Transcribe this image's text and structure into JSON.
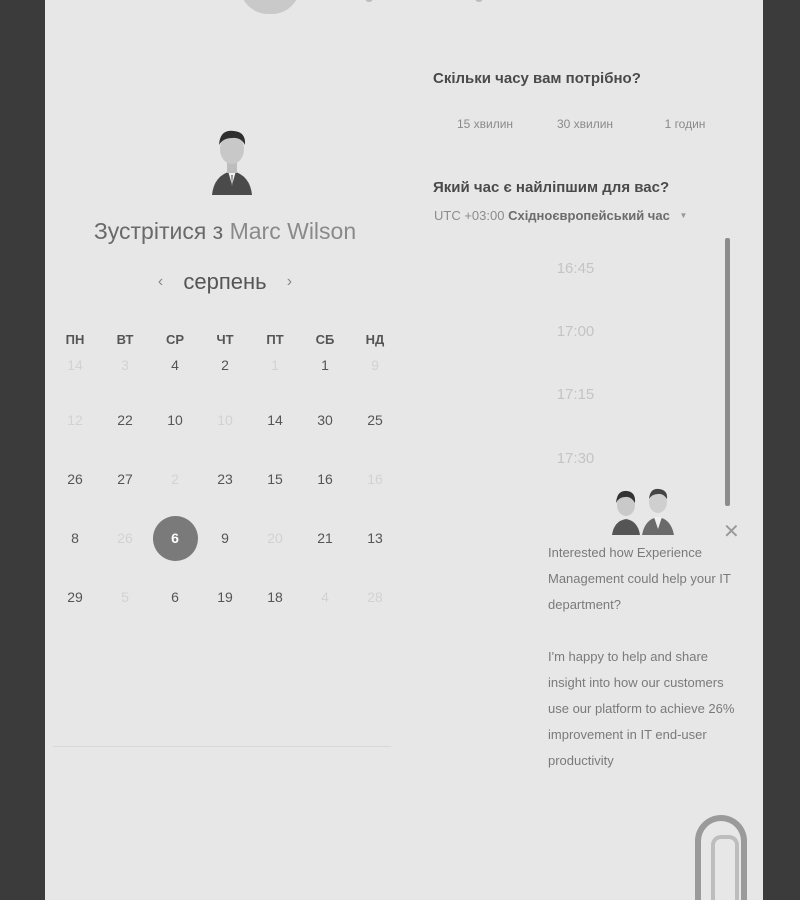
{
  "meeting": {
    "title_prefix": "Зустрітися з",
    "host_name": "Marc Wilson",
    "month": "серпень"
  },
  "calendar": {
    "weekdays": [
      "ПН",
      "ВТ",
      "СР",
      "ЧТ",
      "ПТ",
      "СБ",
      "НД"
    ],
    "rows": [
      [
        {
          "d": "14",
          "dim": true
        },
        {
          "d": "3",
          "dim": true
        },
        {
          "d": "4"
        },
        {
          "d": "2"
        },
        {
          "d": "1",
          "dim": true
        },
        {
          "d": "1"
        },
        {
          "d": "9",
          "dim": true
        }
      ],
      [
        {
          "d": "12",
          "dim": true
        },
        {
          "d": "22"
        },
        {
          "d": "10"
        },
        {
          "d": "10",
          "dim": true
        },
        {
          "d": "14"
        },
        {
          "d": "30"
        },
        {
          "d": "25"
        }
      ],
      [
        {
          "d": "26"
        },
        {
          "d": "27"
        },
        {
          "d": "2",
          "dim": true
        },
        {
          "d": "23"
        },
        {
          "d": "15"
        },
        {
          "d": "16"
        },
        {
          "d": "16",
          "dim": true
        }
      ],
      [
        {
          "d": "8"
        },
        {
          "d": "26",
          "dim": true
        },
        {
          "d": "6",
          "selected": true
        },
        {
          "d": "9"
        },
        {
          "d": "20",
          "dim": true
        },
        {
          "d": "21"
        },
        {
          "d": "13"
        }
      ],
      [
        {
          "d": "29"
        },
        {
          "d": "5",
          "dim": true
        },
        {
          "d": "6"
        },
        {
          "d": "19"
        },
        {
          "d": "18"
        },
        {
          "d": "4",
          "dim": true
        },
        {
          "d": "28",
          "dim": true
        }
      ]
    ]
  },
  "duration": {
    "question": "Скільки часу вам потрібно?",
    "options": [
      "15 хвилин",
      "30 хвилин",
      "1 годин"
    ]
  },
  "time": {
    "question": "Який час є найліпшим для вас?",
    "timezone_offset": "UTC +03:00",
    "timezone_name": "Східноєвропейський час",
    "slots": [
      "16:45",
      "17:00",
      "17:15",
      "17:30"
    ]
  },
  "chat": {
    "message_1": "Interested how Experience Management could help your IT department?",
    "message_2": "I'm happy to help and share insight into how our customers use our platform to achieve 26% improvement in IT end-user productivity",
    "close_glyph": "✕"
  },
  "icons": {
    "prev": "chevron-left-icon",
    "next": "chevron-right-icon",
    "dropdown": "caret-down-icon",
    "close": "close-icon",
    "launcher": "chat-launcher-icon"
  },
  "colors": {
    "page_bg": "#3b3b3b",
    "panel_bg": "#e7e7e7",
    "selected_day": "#7a7a7a"
  }
}
